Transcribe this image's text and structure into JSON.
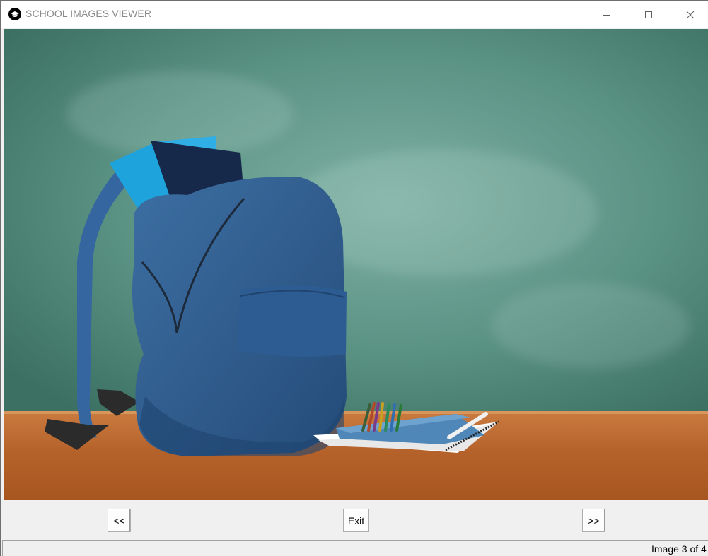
{
  "window": {
    "title": "SCHOOL IMAGES VIEWER",
    "app_icon": "graduation-cap-icon",
    "controls": {
      "minimize_icon": "minimize-icon",
      "maximize_icon": "maximize-icon",
      "close_icon": "close-icon"
    }
  },
  "image": {
    "subject": "blue backpack with books on a wooden desk in front of a green chalkboard",
    "current_index": 3,
    "total": 4
  },
  "controls": {
    "prev_label": "<<",
    "exit_label": "Exit",
    "next_label": ">>"
  },
  "status": {
    "text": "Image 3 of 4"
  },
  "colors": {
    "chalkboard": "#4f8a7d",
    "desk": "#b8662e",
    "backpack": "#2f5e8f"
  }
}
